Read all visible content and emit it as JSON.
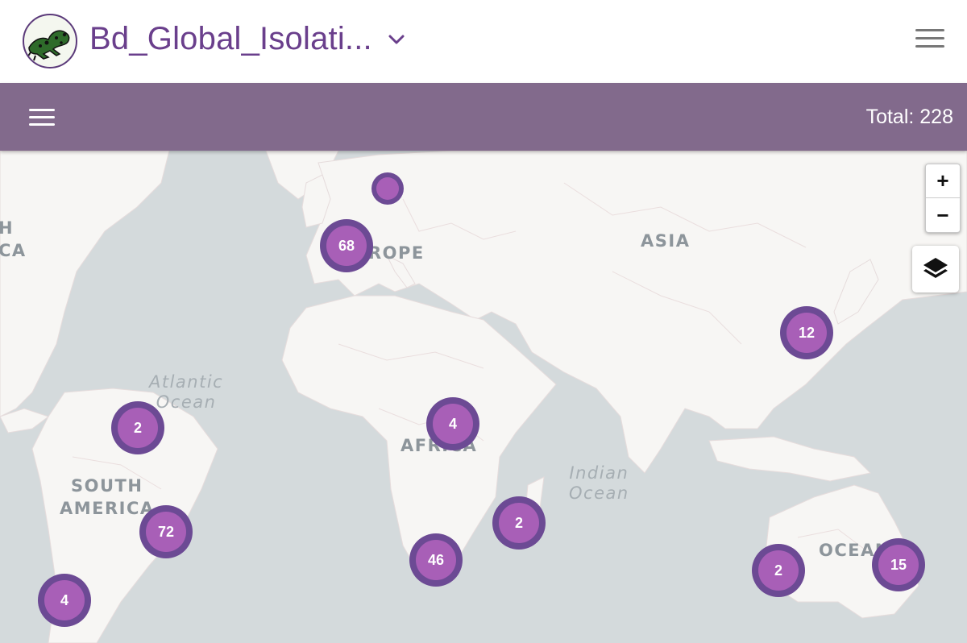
{
  "header": {
    "title": "Bd_Global_Isolati...",
    "logo_icon": "frog-icon",
    "dropdown_icon": "chevron-down-icon",
    "menu_icon": "hamburger-menu-icon"
  },
  "toolbar": {
    "menu_icon": "hamburger-menu-icon",
    "total_label": "Total: 228"
  },
  "map": {
    "controls": {
      "zoom_in": "+",
      "zoom_out": "−",
      "layers_icon": "layers-icon"
    },
    "region_labels": {
      "asia": "ASIA",
      "europe": "ROPE",
      "africa": "AFRICA",
      "south_america_1": "SOUTH",
      "south_america_2": "AMERICA",
      "oceania": "OCEAN",
      "north_america_1": "H",
      "north_america_2": "CA"
    },
    "ocean_labels": {
      "atlantic": "Atlantic\nOcean",
      "indian": "Indian\nOcean"
    },
    "clusters": [
      {
        "id": "uk",
        "count": ""
      },
      {
        "id": "europe",
        "count": "68"
      },
      {
        "id": "east-asia",
        "count": "12"
      },
      {
        "id": "guianas",
        "count": "2"
      },
      {
        "id": "east-africa",
        "count": "4"
      },
      {
        "id": "brazil",
        "count": "72"
      },
      {
        "id": "south-africa",
        "count": "46"
      },
      {
        "id": "madagascar",
        "count": "2"
      },
      {
        "id": "chile",
        "count": "4"
      },
      {
        "id": "west-australia",
        "count": "2"
      },
      {
        "id": "east-australia",
        "count": "15"
      }
    ]
  },
  "colors": {
    "accent": "#6a3f8c",
    "toolbar": "#826a8c",
    "cluster_outer": "#6c4a94",
    "cluster_inner": "#a85fb7",
    "water": "#d4dadc",
    "land": "#f7f6f4"
  }
}
